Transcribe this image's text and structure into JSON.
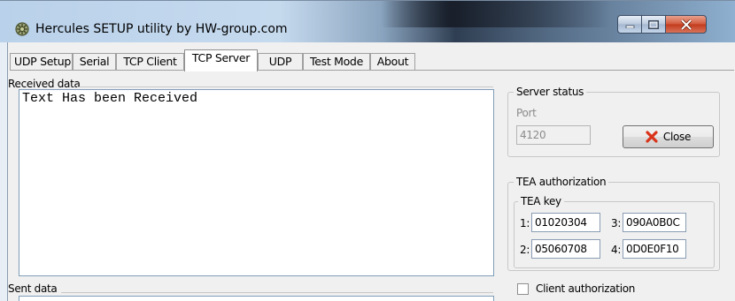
{
  "window": {
    "title": "Hercules SETUP utility by HW-group.com"
  },
  "tabs": [
    {
      "label": "UDP Setup"
    },
    {
      "label": "Serial"
    },
    {
      "label": "TCP Client"
    },
    {
      "label": "TCP Server",
      "active": true
    },
    {
      "label": "UDP"
    },
    {
      "label": "Test Mode"
    },
    {
      "label": "About"
    }
  ],
  "received": {
    "label": "Received data",
    "text": "Text Has been Received"
  },
  "sent": {
    "label": "Sent data"
  },
  "server_status": {
    "group_label": "Server status",
    "port_label": "Port",
    "port_value": "4120",
    "close_label": "Close"
  },
  "tea": {
    "group_label": "TEA authorization",
    "key_group_label": "TEA key",
    "keys": [
      {
        "label": "1:",
        "value": "01020304"
      },
      {
        "label": "2:",
        "value": "05060708"
      },
      {
        "label": "3:",
        "value": "090A0B0C"
      },
      {
        "label": "4:",
        "value": "0D0E0F10"
      }
    ]
  },
  "client_auth": {
    "label": "Client authorization",
    "checked": false
  },
  "colors": {
    "close_x": "#d9331a",
    "accent_border": "#7f9db9"
  }
}
